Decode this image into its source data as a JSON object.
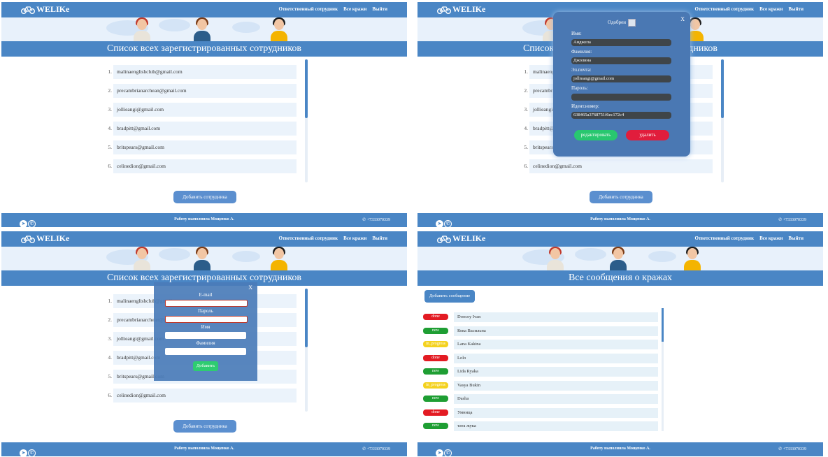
{
  "brand": "WELIKe",
  "nav": {
    "responsible": "Ответственный сотрудник",
    "thefts": "Все кражи",
    "logout": "Выйти"
  },
  "employees_title": "Список всех зарегистрированных сотрудников",
  "employees": [
    {
      "num": "1.",
      "email": "malinaenglishclub@gmail.com"
    },
    {
      "num": "2.",
      "email": "precambrianarchean@gmail.com"
    },
    {
      "num": "3.",
      "email": "jollieangi@gmail.com"
    },
    {
      "num": "4.",
      "email": "bradpitt@gmail.com"
    },
    {
      "num": "5.",
      "email": "britspears@gmail.com"
    },
    {
      "num": "6.",
      "email": "celinedion@gmail.com"
    }
  ],
  "add_employee": "Добавить сотрудника",
  "footer": {
    "credit": "Работу выполнила Мощенко А.",
    "phone": "+7333070339"
  },
  "edit_modal": {
    "close": "X",
    "approved": "Одобрен",
    "name_label": "Имя:",
    "name": "Анджела",
    "surname_label": "Фамилия:",
    "surname": "Джолина",
    "email_label": "Эл.почта:",
    "email": "jollieangi@gmail.com",
    "password_label": "Пароль:",
    "password": "",
    "id_label": "Идент.номер:",
    "id": "638465a3768751f6ec172c4",
    "edit": "редактировать",
    "delete": "удалить"
  },
  "add_modal": {
    "close": "X",
    "email": "E-mail",
    "password": "Пароль",
    "name": "Имя",
    "surname": "Фамилия",
    "submit": "Добавить"
  },
  "thefts_title": "Все сообщения о кражах",
  "add_message": "Добавить сообщение",
  "thefts": [
    {
      "status": "done",
      "name": "Doocey Ivan"
    },
    {
      "status": "new",
      "name": "Кека Васильна"
    },
    {
      "status": "in_progress",
      "name": "Lana Kakina"
    },
    {
      "status": "done",
      "name": "Lolo"
    },
    {
      "status": "new",
      "name": "Lida Ryaka"
    },
    {
      "status": "in_progress",
      "name": "Vasya Bukin"
    },
    {
      "status": "new",
      "name": "Dasha"
    },
    {
      "status": "done",
      "name": "Умница"
    },
    {
      "status": "new",
      "name": "тата жука"
    }
  ],
  "colors": {
    "primary": "#4a86c5",
    "done": "#e31b23",
    "new": "#1e9e33",
    "in_progress": "#f4d21f"
  }
}
